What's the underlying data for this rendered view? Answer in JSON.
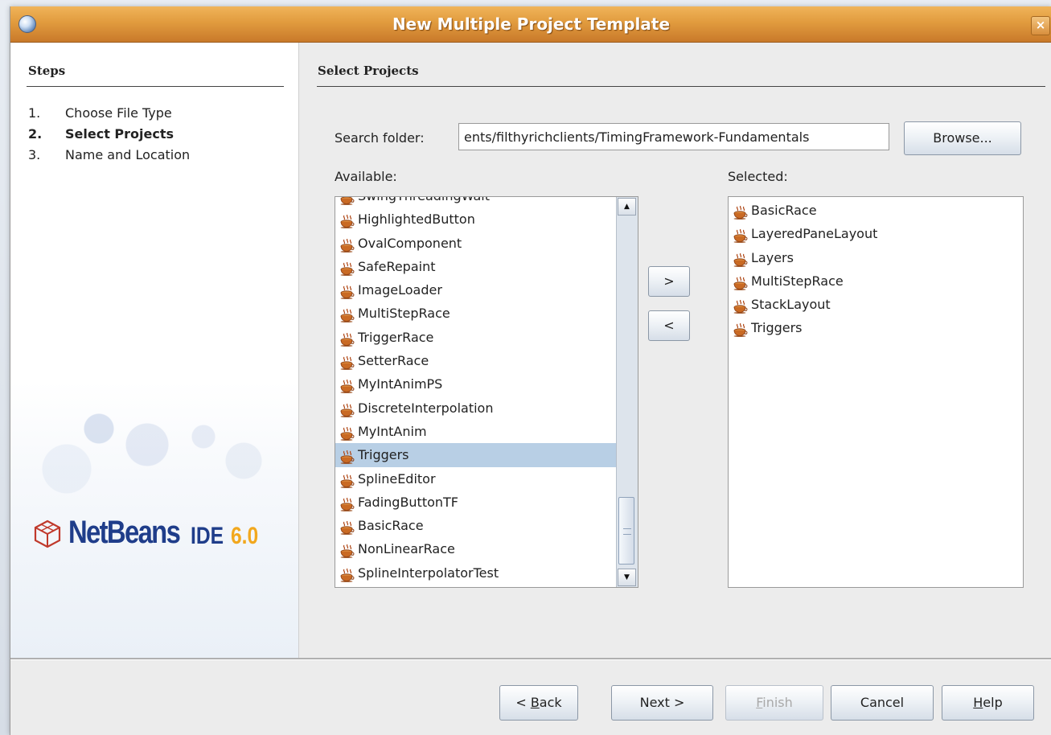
{
  "window": {
    "title": "New Multiple Project Template",
    "close_label": "×"
  },
  "steps": {
    "heading": "Steps",
    "items": [
      {
        "num": "1.",
        "label": "Choose File Type"
      },
      {
        "num": "2.",
        "label": "Select Projects"
      },
      {
        "num": "3.",
        "label": "Name and Location"
      }
    ]
  },
  "branding": {
    "netbeans": "NetBeans",
    "ide": "IDE",
    "version": "6.0"
  },
  "panel": {
    "title": "Select Projects",
    "search_label": "Search folder:",
    "search_value": "ents/filthyrichclients/TimingFramework-Fundamentals",
    "browse_label": "Browse...",
    "available_label": "Available:",
    "selected_label": "Selected:",
    "add_label": ">",
    "remove_label": "<",
    "available": [
      "SwingThreadingWait",
      "HighlightedButton",
      "OvalComponent",
      "SafeRepaint",
      "ImageLoader",
      "MultiStepRace",
      "TriggerRace",
      "SetterRace",
      "MyIntAnimPS",
      "DiscreteInterpolation",
      "MyIntAnim",
      "Triggers",
      "SplineEditor",
      "FadingButtonTF",
      "BasicRace",
      "NonLinearRace",
      "SplineInterpolatorTest"
    ],
    "available_selected": "Triggers",
    "selected": [
      "BasicRace",
      "LayeredPaneLayout",
      "Layers",
      "MultiStepRace",
      "StackLayout",
      "Triggers"
    ]
  },
  "footer": {
    "back": {
      "prefix": "< ",
      "mnemonic": "B",
      "rest": "ack"
    },
    "next": "Next >",
    "finish": {
      "mnemonic": "F",
      "rest": "inish"
    },
    "cancel": "Cancel",
    "help": {
      "mnemonic": "H",
      "rest": "elp"
    }
  },
  "colors": {
    "titlebar": "#e19b3e",
    "list_selection": "#b8cfe5",
    "logo_blue": "#1f3d8a",
    "logo_orange": "#f2a81e"
  }
}
